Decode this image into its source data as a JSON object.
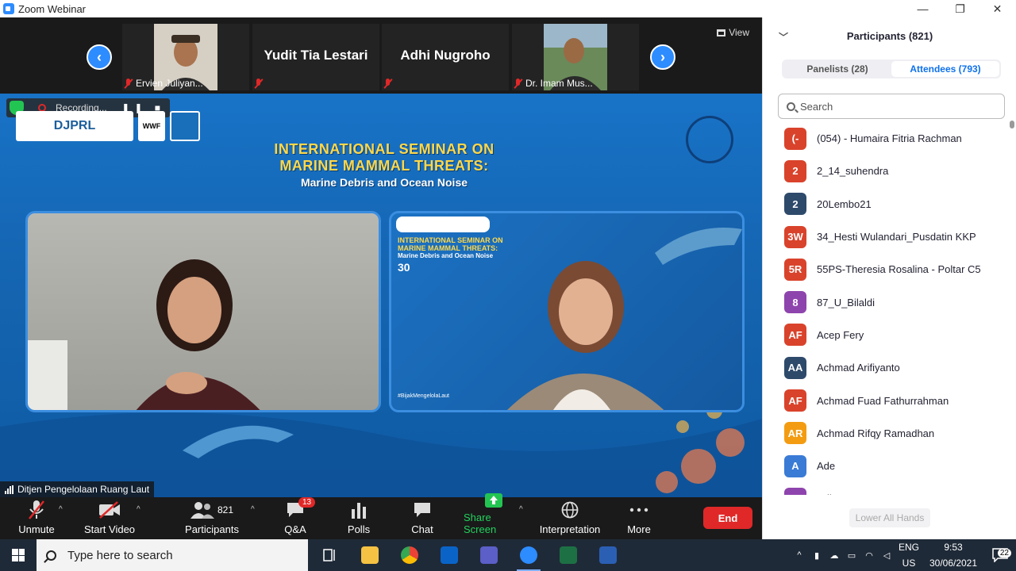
{
  "window": {
    "title": "Zoom Webinar"
  },
  "window_controls": {
    "minimize": "—",
    "restore": "❐",
    "close": "✕"
  },
  "video_strip": {
    "tiles": [
      {
        "name": "Ervien Juliyan...",
        "has_photo": true
      },
      {
        "name": "Yudit Tia Lestari",
        "has_photo": false
      },
      {
        "name": "Adhi Nugroho",
        "has_photo": false
      },
      {
        "name": "Dr. Imam Mus...",
        "has_photo": true
      }
    ],
    "prev_arrow": "‹",
    "next_arrow": "›",
    "view_label": "View"
  },
  "share": {
    "recording_label": "Recording...",
    "logo_text": "DJPRL",
    "logo_text2": "WWF",
    "title_line1": "INTERNATIONAL SEMINAR ON",
    "title_line2": "MARINE MAMMAL THREATS:",
    "title_line3": "Marine Debris and Ocean Noise",
    "mini_title_line1": "INTERNATIONAL SEMINAR ON",
    "mini_title_line2": "MARINE MAMMAL THREATS:",
    "mini_title_line3": "Marine Debris and Ocean Noise",
    "mini_date": "30",
    "hashtag": "#BijakMengelolaLaut",
    "presenter_name": "Ditjen Pengelolaan Ruang Laut"
  },
  "toolbar": {
    "unmute": "Unmute",
    "start_video": "Start Video",
    "participants": "Participants",
    "participants_count": "821",
    "qa": "Q&A",
    "qa_badge": "13",
    "polls": "Polls",
    "chat": "Chat",
    "share_screen": "Share Screen",
    "interpretation": "Interpretation",
    "more": "More",
    "end": "End"
  },
  "panel": {
    "title": "Participants (821)",
    "tabs": [
      {
        "label": "Panelists (28)",
        "active": false
      },
      {
        "label": "Attendees (793)",
        "active": true
      }
    ],
    "search_placeholder": "Search",
    "attendees": [
      {
        "initials": "(-",
        "name": "(054) - Humaira Fitria Rachman",
        "color": "#d9432b"
      },
      {
        "initials": "2",
        "name": "2_14_suhendra",
        "color": "#d9432b"
      },
      {
        "initials": "2",
        "name": "20Lembo21",
        "color": "#2e4a6b"
      },
      {
        "initials": "3W",
        "name": "34_Hesti Wulandari_Pusdatin KKP",
        "color": "#d9432b"
      },
      {
        "initials": "5R",
        "name": "55PS-Theresia Rosalina - Poltar C5",
        "color": "#d9432b"
      },
      {
        "initials": "8",
        "name": "87_U_Bilaldi",
        "color": "#8e44ad"
      },
      {
        "initials": "AF",
        "name": "Acep Fery",
        "color": "#d9432b"
      },
      {
        "initials": "AA",
        "name": "Achmad Arifiyanto",
        "color": "#2e4a6b"
      },
      {
        "initials": "AF",
        "name": "Achmad Fuad Fathurrahman",
        "color": "#d9432b"
      },
      {
        "initials": "AR",
        "name": "Achmad Rifqy Ramadhan",
        "color": "#f39c12"
      },
      {
        "initials": "A",
        "name": "Ade",
        "color": "#3a7bd5"
      },
      {
        "initials": "AA",
        "name": "Adi...",
        "color": "#8e44ad"
      }
    ],
    "lower_all_hands": "Lower All Hands"
  },
  "taskbar": {
    "search_placeholder": "Type here to search",
    "lang_line1": "ENG",
    "lang_line2": "US",
    "time": "9:53",
    "date": "30/06/2021",
    "notifications": "22",
    "tray_chevron": "^"
  }
}
